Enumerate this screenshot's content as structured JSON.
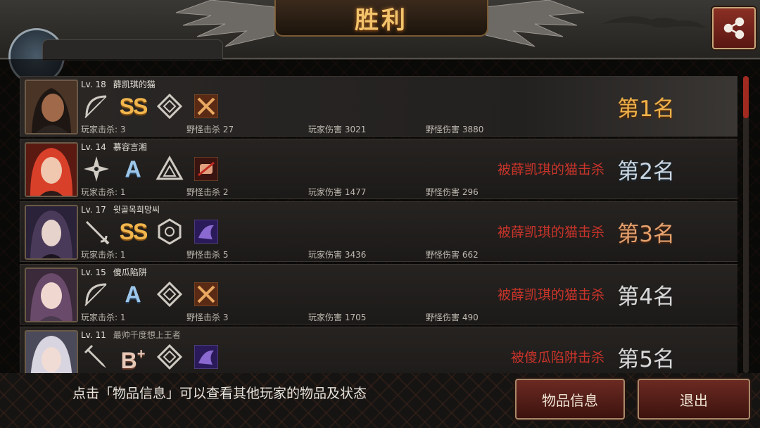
{
  "header": {
    "title": "胜利",
    "share_icon": "share-icon"
  },
  "colors": {
    "title_gold": "#f2c36b",
    "rank_gold": "#f0b24a",
    "killed_red": "#c8342a",
    "button_red": "#6b2a22"
  },
  "players": [
    {
      "level": "Lv. 18",
      "name": "薛凯琪的猫",
      "grade": "SS",
      "weapon_icon": "bow-icon",
      "class_icon": "diamond-emblem-icon",
      "skill_icon": "crossed-blades-skill-icon",
      "stats": {
        "player_kills": "玩家击杀: 3",
        "monster_kills": "野怪击杀 27",
        "player_damage": "玩家伤害 3021",
        "monster_damage": "野怪伤害 3880"
      },
      "killed_by": "",
      "rank": "第1名"
    },
    {
      "level": "Lv. 14",
      "name": "慕容言湘",
      "grade": "A",
      "weapon_icon": "shuriken-icon",
      "class_icon": "triangle-emblem-icon",
      "skill_icon": "fist-skill-icon",
      "stats": {
        "player_kills": "玩家击杀: 1",
        "monster_kills": "野怪击杀 2",
        "player_damage": "玩家伤害 1477",
        "monster_damage": "野怪伤害 296"
      },
      "killed_by": "被薛凯琪的猫击杀",
      "rank": "第2名"
    },
    {
      "level": "Lv. 17",
      "name": "윗골목희망씨",
      "grade": "SS",
      "weapon_icon": "rapier-icon",
      "class_icon": "hexagon-emblem-icon",
      "skill_icon": "shadow-skill-icon",
      "stats": {
        "player_kills": "玩家击杀: 1",
        "monster_kills": "野怪击杀 5",
        "player_damage": "玩家伤害 3436",
        "monster_damage": "野怪伤害 662"
      },
      "killed_by": "被薛凯琪的猫击杀",
      "rank": "第3名"
    },
    {
      "level": "Lv. 15",
      "name": "傻瓜陷阱",
      "grade": "A",
      "weapon_icon": "bow-icon",
      "class_icon": "diamond-emblem-icon",
      "skill_icon": "crossed-blades-skill-icon",
      "stats": {
        "player_kills": "玩家击杀: 1",
        "monster_kills": "野怪击杀 3",
        "player_damage": "玩家伤害 1705",
        "monster_damage": "野怪伤害 490"
      },
      "killed_by": "被薛凯琪的猫击杀",
      "rank": "第4名"
    },
    {
      "level": "Lv. 11",
      "name": "最帅千度想上王者",
      "grade": "B+",
      "weapon_icon": "dagger-icon",
      "class_icon": "diamond-emblem-icon",
      "skill_icon": "shadow-skill-icon",
      "stats": {
        "player_kills": "",
        "monster_kills": "",
        "player_damage": "",
        "monster_damage": ""
      },
      "killed_by": "被傻瓜陷阱击杀",
      "rank": "第5名"
    }
  ],
  "footer": {
    "hint": "点击「物品信息」可以查看其他玩家的物品及状态",
    "items_button": "物品信息",
    "exit_button": "退出"
  }
}
